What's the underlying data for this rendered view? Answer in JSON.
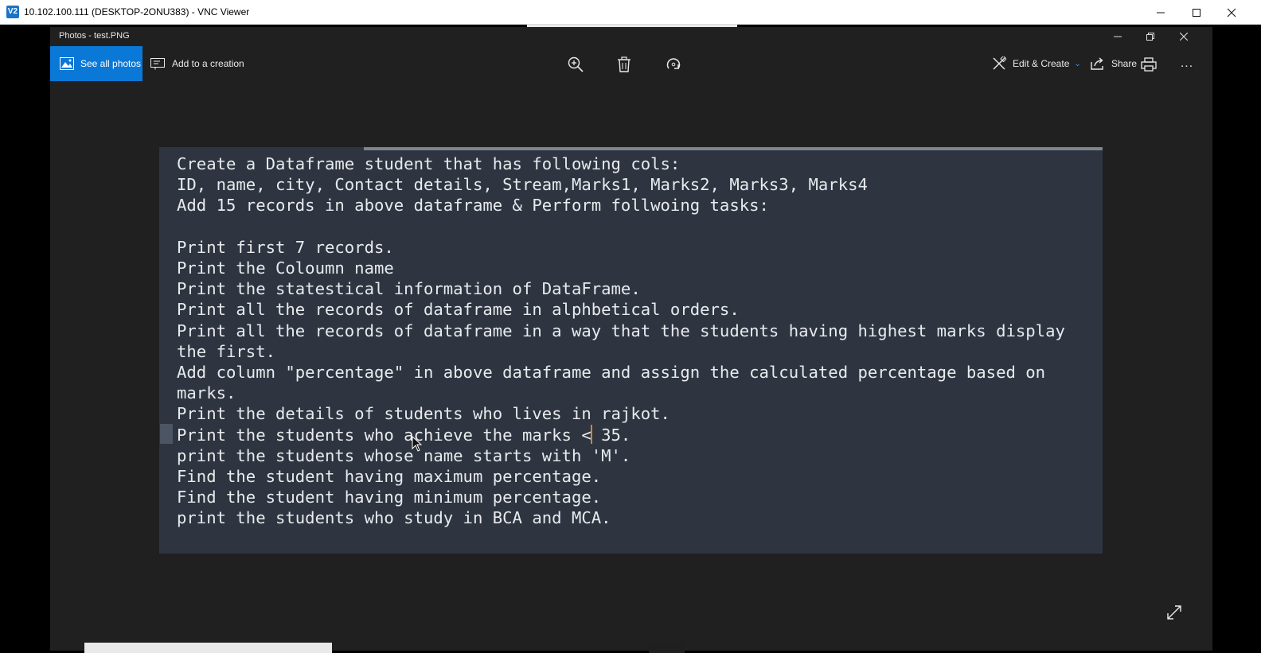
{
  "vnc": {
    "logo": "V2",
    "title": "10.102.100.111 (DESKTOP-2ONU383) - VNC Viewer"
  },
  "photos": {
    "title": "Photos - test.PNG",
    "toolbar": {
      "see_all_label": "See all photos",
      "add_creation_label": "Add to a creation",
      "edit_create_label": "Edit & Create",
      "share_label": "Share",
      "more_label": "..."
    }
  },
  "image": {
    "lines": [
      "Create a Dataframe student that has following cols:",
      "ID, name, city, Contact details, Stream,Marks1, Marks2, Marks3, Marks4",
      "Add 15 records in above dataframe & Perform follwoing tasks:",
      "",
      "Print first 7 records.",
      "Print the Coloumn name",
      "Print the statestical information of DataFrame.",
      "Print all the records of dataframe in alphbetical orders.",
      "Print all the records of dataframe in a way that the students having highest marks display",
      "the first.",
      "Add column \"percentage\" in above dataframe and assign the calculated percentage based on",
      "marks.",
      "Print the details of students who lives in rajkot.",
      "Print the students who achieve the marks < 35.",
      "print the students whose name starts with 'M'.",
      "Find the student having maximum percentage.",
      "Find the student having minimum percentage.",
      "print the students who study in BCA and MCA."
    ]
  },
  "colors": {
    "accent": "#0a78d7",
    "app_bg": "#202020",
    "image_bg": "#2e3540"
  },
  "icons": [
    "zoom-in-icon",
    "delete-icon",
    "rotate-icon",
    "edit-create-icon",
    "share-icon",
    "print-icon",
    "expand-icon"
  ]
}
